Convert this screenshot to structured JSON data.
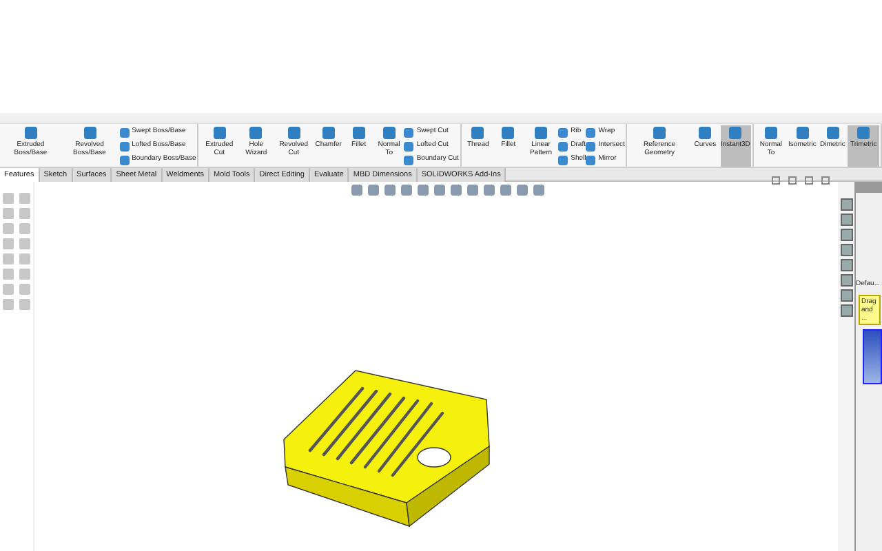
{
  "ribbon": {
    "groups": [
      {
        "items": [
          {
            "kind": "large",
            "label": "Extruded Boss/Base",
            "selected": false
          },
          {
            "kind": "large",
            "label": "Revolved Boss/Base",
            "selected": false
          },
          {
            "kind": "stack",
            "items": [
              "Swept Boss/Base",
              "Lofted Boss/Base",
              "Boundary Boss/Base"
            ]
          }
        ]
      },
      {
        "items": [
          {
            "kind": "large",
            "label": "Extruded Cut",
            "selected": false
          },
          {
            "kind": "large",
            "label": "Hole Wizard",
            "selected": false
          },
          {
            "kind": "large",
            "label": "Revolved Cut",
            "selected": false
          },
          {
            "kind": "large",
            "label": "Chamfer",
            "selected": false
          },
          {
            "kind": "large",
            "label": "Fillet",
            "selected": false
          },
          {
            "kind": "large",
            "label": "Normal To",
            "selected": false
          },
          {
            "kind": "stack",
            "items": [
              "Swept Cut",
              "Lofted Cut",
              "Boundary Cut"
            ]
          }
        ]
      },
      {
        "items": [
          {
            "kind": "large",
            "label": "Thread",
            "selected": false
          },
          {
            "kind": "large",
            "label": "Fillet",
            "selected": false
          },
          {
            "kind": "large",
            "label": "Linear Pattern",
            "selected": false
          },
          {
            "kind": "stack",
            "items": [
              "Rib",
              "Draft",
              "Shell"
            ]
          },
          {
            "kind": "stack",
            "items": [
              "Wrap",
              "Intersect",
              "Mirror"
            ]
          }
        ]
      },
      {
        "items": [
          {
            "kind": "large",
            "label": "Reference Geometry",
            "selected": false
          },
          {
            "kind": "large",
            "label": "Curves",
            "selected": false
          },
          {
            "kind": "large",
            "label": "Instant3D",
            "selected": true
          }
        ]
      },
      {
        "items": [
          {
            "kind": "large",
            "label": "Normal To",
            "selected": false
          },
          {
            "kind": "large",
            "label": "Isometric",
            "selected": false
          },
          {
            "kind": "large",
            "label": "Dimetric",
            "selected": false
          },
          {
            "kind": "large",
            "label": "Trimetric",
            "selected": true
          }
        ]
      }
    ]
  },
  "tabs": [
    {
      "label": "Features",
      "selected": true
    },
    {
      "label": "Sketch",
      "selected": false
    },
    {
      "label": "Surfaces",
      "selected": false
    },
    {
      "label": "Sheet Metal",
      "selected": false
    },
    {
      "label": "Weldments",
      "selected": false
    },
    {
      "label": "Mold Tools",
      "selected": false
    },
    {
      "label": "Direct Editing",
      "selected": false
    },
    {
      "label": "Evaluate",
      "selected": false
    },
    {
      "label": "MBD Dimensions",
      "selected": false
    },
    {
      "label": "SOLIDWORKS Add-Ins",
      "selected": false
    }
  ],
  "task_pane": {
    "heading": "Defau...",
    "note": "Drag and ..."
  }
}
